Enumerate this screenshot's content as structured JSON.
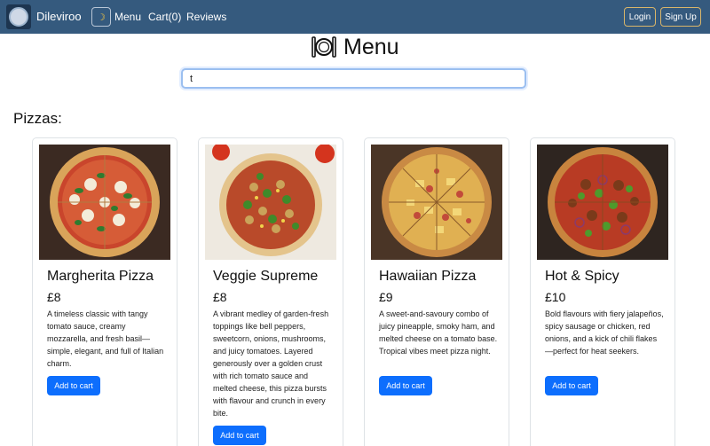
{
  "navbar": {
    "brand": "Dileviroo",
    "theme_icon": "moon-icon",
    "links": {
      "menu": "Menu",
      "cart": "Cart(0)",
      "reviews": "Reviews"
    },
    "login": "Login",
    "signup": "Sign Up"
  },
  "page": {
    "title": "Menu",
    "title_icon": "plate-cutlery-icon"
  },
  "search": {
    "value": "t"
  },
  "section": {
    "title": "Pizzas:"
  },
  "products": [
    {
      "name": "Margherita Pizza",
      "price": "£8",
      "description": "A timeless classic with tangy tomato sauce, creamy mozzarella, and fresh basil—simple, elegant, and full of Italian charm.",
      "button": "Add to cart"
    },
    {
      "name": "Veggie Supreme",
      "price": "£8",
      "description": "A vibrant medley of garden-fresh toppings like bell peppers, sweetcorn, onions, mushrooms, and juicy tomatoes. Layered generously over a golden crust with rich tomato sauce and melted cheese, this pizza bursts with flavour and crunch in every bite.",
      "button": "Add to cart"
    },
    {
      "name": "Hawaiian Pizza",
      "price": "£9",
      "description": "A sweet-and-savoury combo of juicy pineapple, smoky ham, and melted cheese on a tomato base. Tropical vibes meet pizza night.",
      "button": "Add to cart"
    },
    {
      "name": "Hot & Spicy",
      "price": "£10",
      "description": "Bold flavours with fiery jalapeños, spicy sausage or chicken, red onions, and a kick of chili flakes—perfect for heat seekers.",
      "button": "Add to cart"
    }
  ]
}
